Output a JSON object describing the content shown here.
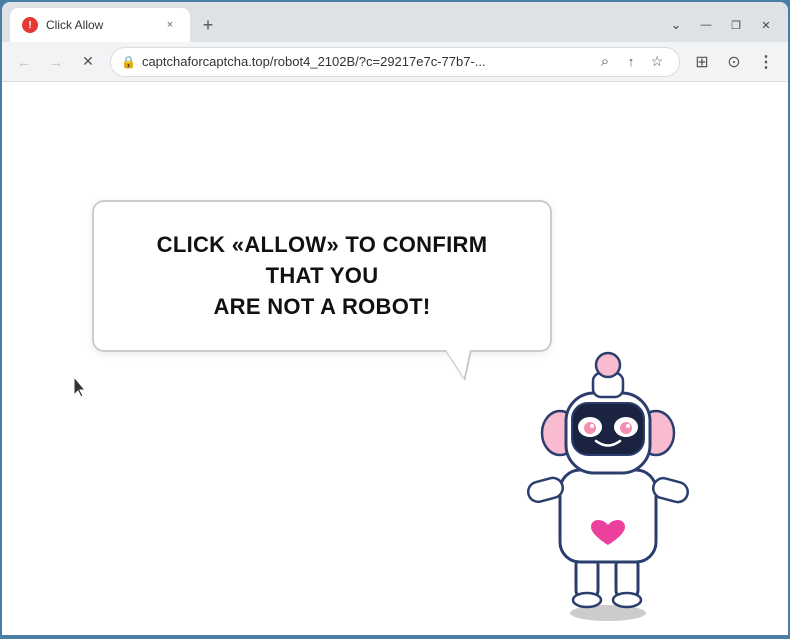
{
  "browser": {
    "tab": {
      "favicon_letter": "!",
      "title": "Click Allow",
      "close_label": "×"
    },
    "new_tab_label": "+",
    "window_controls": {
      "minimize": "—",
      "maximize": "❐",
      "close": "✕"
    },
    "toolbar": {
      "back_icon": "←",
      "forward_icon": "→",
      "reload_icon": "✕",
      "lock_icon": "🔒",
      "address": "captchaforcaptcha.top/robot4_2102B/?c=29217e7c-77b7-...",
      "search_icon": "⌕",
      "share_icon": "⇧",
      "bookmark_icon": "☆",
      "extensions_icon": "⊞",
      "profile_icon": "⊙",
      "menu_icon": "⋮"
    }
  },
  "page": {
    "bubble_text_line1": "CLICK «ALLOW» TO CONFIRM THAT YOU",
    "bubble_text_line2": "ARE NOT A ROBOT!"
  }
}
